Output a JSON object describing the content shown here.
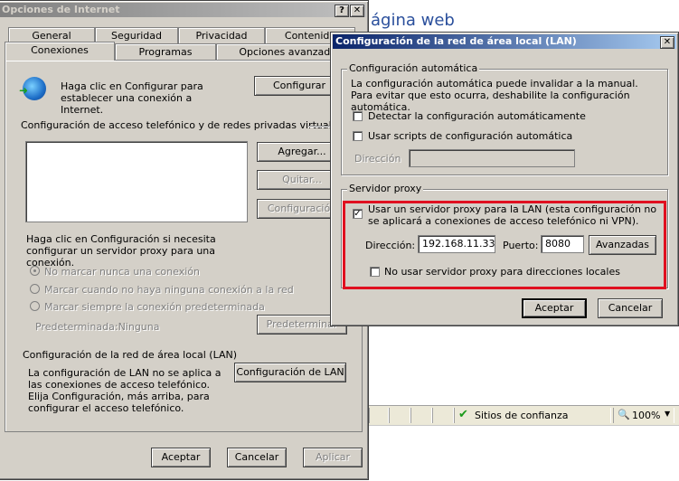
{
  "browser": {
    "heading": "ágina web",
    "status_zone": "Sitios de confianza",
    "zoom": "100%"
  },
  "internet_options": {
    "title": "Opciones de Internet",
    "tabs_back": [
      "General",
      "Seguridad",
      "Privacidad",
      "Contenido"
    ],
    "tabs_front": [
      "Conexiones",
      "Programas",
      "Opciones avanzadas"
    ],
    "setup_text": "Haga clic en Configurar para establecer una conexión a Internet.",
    "setup_button": "Configurar",
    "dialup_group": "Configuración de acceso telefónico y de redes privadas virtuales",
    "add_button": "Agregar...",
    "remove_button": "Quitar...",
    "settings_button": "Configuración",
    "proxy_hint": "Haga clic en Configuración si necesita configurar un servidor proxy para una conexión.",
    "radio_never": "No marcar nunca una conexión",
    "radio_when_none": "Marcar cuando no haya ninguna conexión a la red",
    "radio_always": "Marcar siempre la conexión predeterminada",
    "default_label": "Predeterminada:",
    "default_value": "Ninguna",
    "set_default_button": "Predeterminar",
    "lan_group": "Configuración de la red de área local (LAN)",
    "lan_text": "La configuración de LAN no se aplica a las conexiones de acceso telefónico. Elija Configuración, más arriba, para configurar el acceso telefónico.",
    "lan_button": "Configuración de LAN",
    "ok": "Aceptar",
    "cancel": "Cancelar",
    "apply": "Aplicar"
  },
  "lan_dialog": {
    "title": "Configuración de la red de área local (LAN)",
    "auto_group": "Configuración automática",
    "auto_text": "La configuración automática puede invalidar a la manual. Para evitar que esto ocurra, deshabilite la configuración automática.",
    "auto_detect": "Detectar la configuración automáticamente",
    "use_script": "Usar scripts de configuración automática",
    "address_label_disabled": "Dirección",
    "proxy_group": "Servidor proxy",
    "use_proxy": "Usar un servidor proxy para la LAN (esta configuración no se aplicará a conexiones de acceso telefónico ni VPN).",
    "address_label": "Dirección:",
    "address_value": "192.168.11.33",
    "port_label": "Puerto:",
    "port_value": "8080",
    "advanced_button": "Avanzadas",
    "bypass_local": "No usar servidor proxy para direcciones locales",
    "ok": "Aceptar",
    "cancel": "Cancelar",
    "use_proxy_checked": true,
    "highlight_color": "#e01020"
  }
}
